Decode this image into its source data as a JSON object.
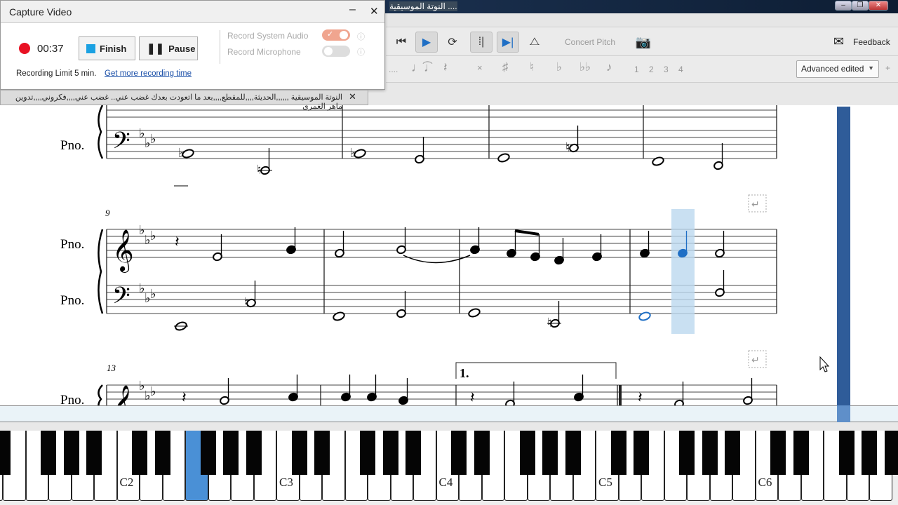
{
  "window": {
    "title": "النوتة الموسيقية ....",
    "controls": [
      "minimize",
      "maximize",
      "close"
    ]
  },
  "capture": {
    "title": "Capture Video",
    "timer": "00:37",
    "finish": "Finish",
    "pause": "Pause",
    "system_audio": "Record System Audio",
    "system_audio_on": true,
    "microphone": "Record Microphone",
    "microphone_on": false,
    "limit": "Recording Limit 5 min.",
    "more_link": "Get more recording time",
    "record_color": "#e81123"
  },
  "tab": {
    "label": "النوتة الموسيقية ,,,,,,الحديثة,,,,للمقطع,,,,بعد ما اتعودت بعدك غضب عني.. غضب عني,,,,فكروني,,,,تدوين ماهر الغمرى"
  },
  "toolbar": {
    "concert_pitch": "Concert Pitch",
    "feedback": "Feedback",
    "voices": [
      "1",
      "2",
      "3",
      "4"
    ],
    "workspace": "Advanced edited",
    "plus": "+",
    "accent": "#1f6fc5"
  },
  "score": {
    "instrument": "Pno.",
    "measure_numbers": [
      "9",
      "13"
    ],
    "volta": "1.",
    "key": "E♭ major (3 flats)",
    "selected_color": "#1f6fc5"
  },
  "keyboard": {
    "labels": [
      "C2",
      "C3",
      "C4",
      "C5",
      "C6"
    ],
    "highlighted": "F2",
    "highlight_color": "#4a90d6"
  }
}
